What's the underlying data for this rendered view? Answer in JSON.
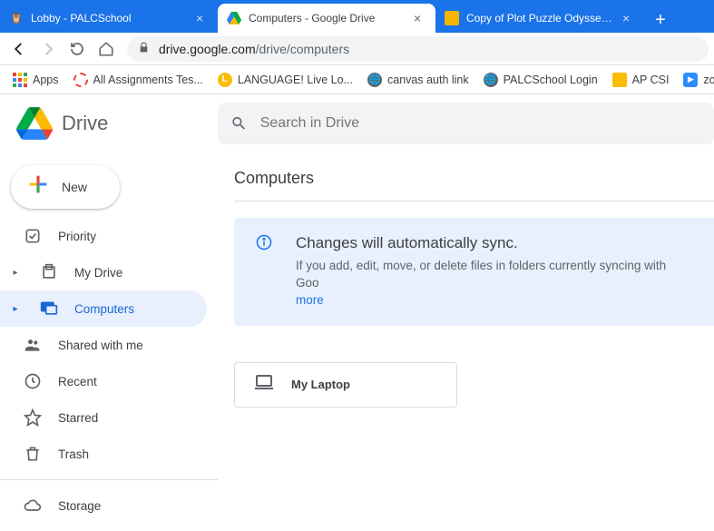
{
  "tabs": [
    {
      "title": "Lobby - PALCSchool"
    },
    {
      "title": "Computers - Google Drive"
    },
    {
      "title": "Copy of Plot Puzzle Odyssey - Go"
    }
  ],
  "url": {
    "host": "drive.google.com",
    "path": "/drive/computers"
  },
  "bookmarks": {
    "apps": "Apps",
    "items": [
      "All Assignments Tes...",
      "LANGUAGE! Live Lo...",
      "canvas auth link",
      "PALCSchool Login",
      "AP CSI",
      "zoom.us"
    ]
  },
  "drive": {
    "logo_text": "Drive",
    "search_placeholder": "Search in Drive",
    "new_label": "New"
  },
  "nav": {
    "priority": "Priority",
    "mydrive": "My Drive",
    "computers": "Computers",
    "shared": "Shared with me",
    "recent": "Recent",
    "starred": "Starred",
    "trash": "Trash",
    "storage": "Storage"
  },
  "main": {
    "title": "Computers",
    "banner_heading": "Changes will automatically sync.",
    "banner_body": "If you add, edit, move, or delete files in folders currently syncing with Goo",
    "banner_more": "more",
    "device_name": "My Laptop"
  }
}
